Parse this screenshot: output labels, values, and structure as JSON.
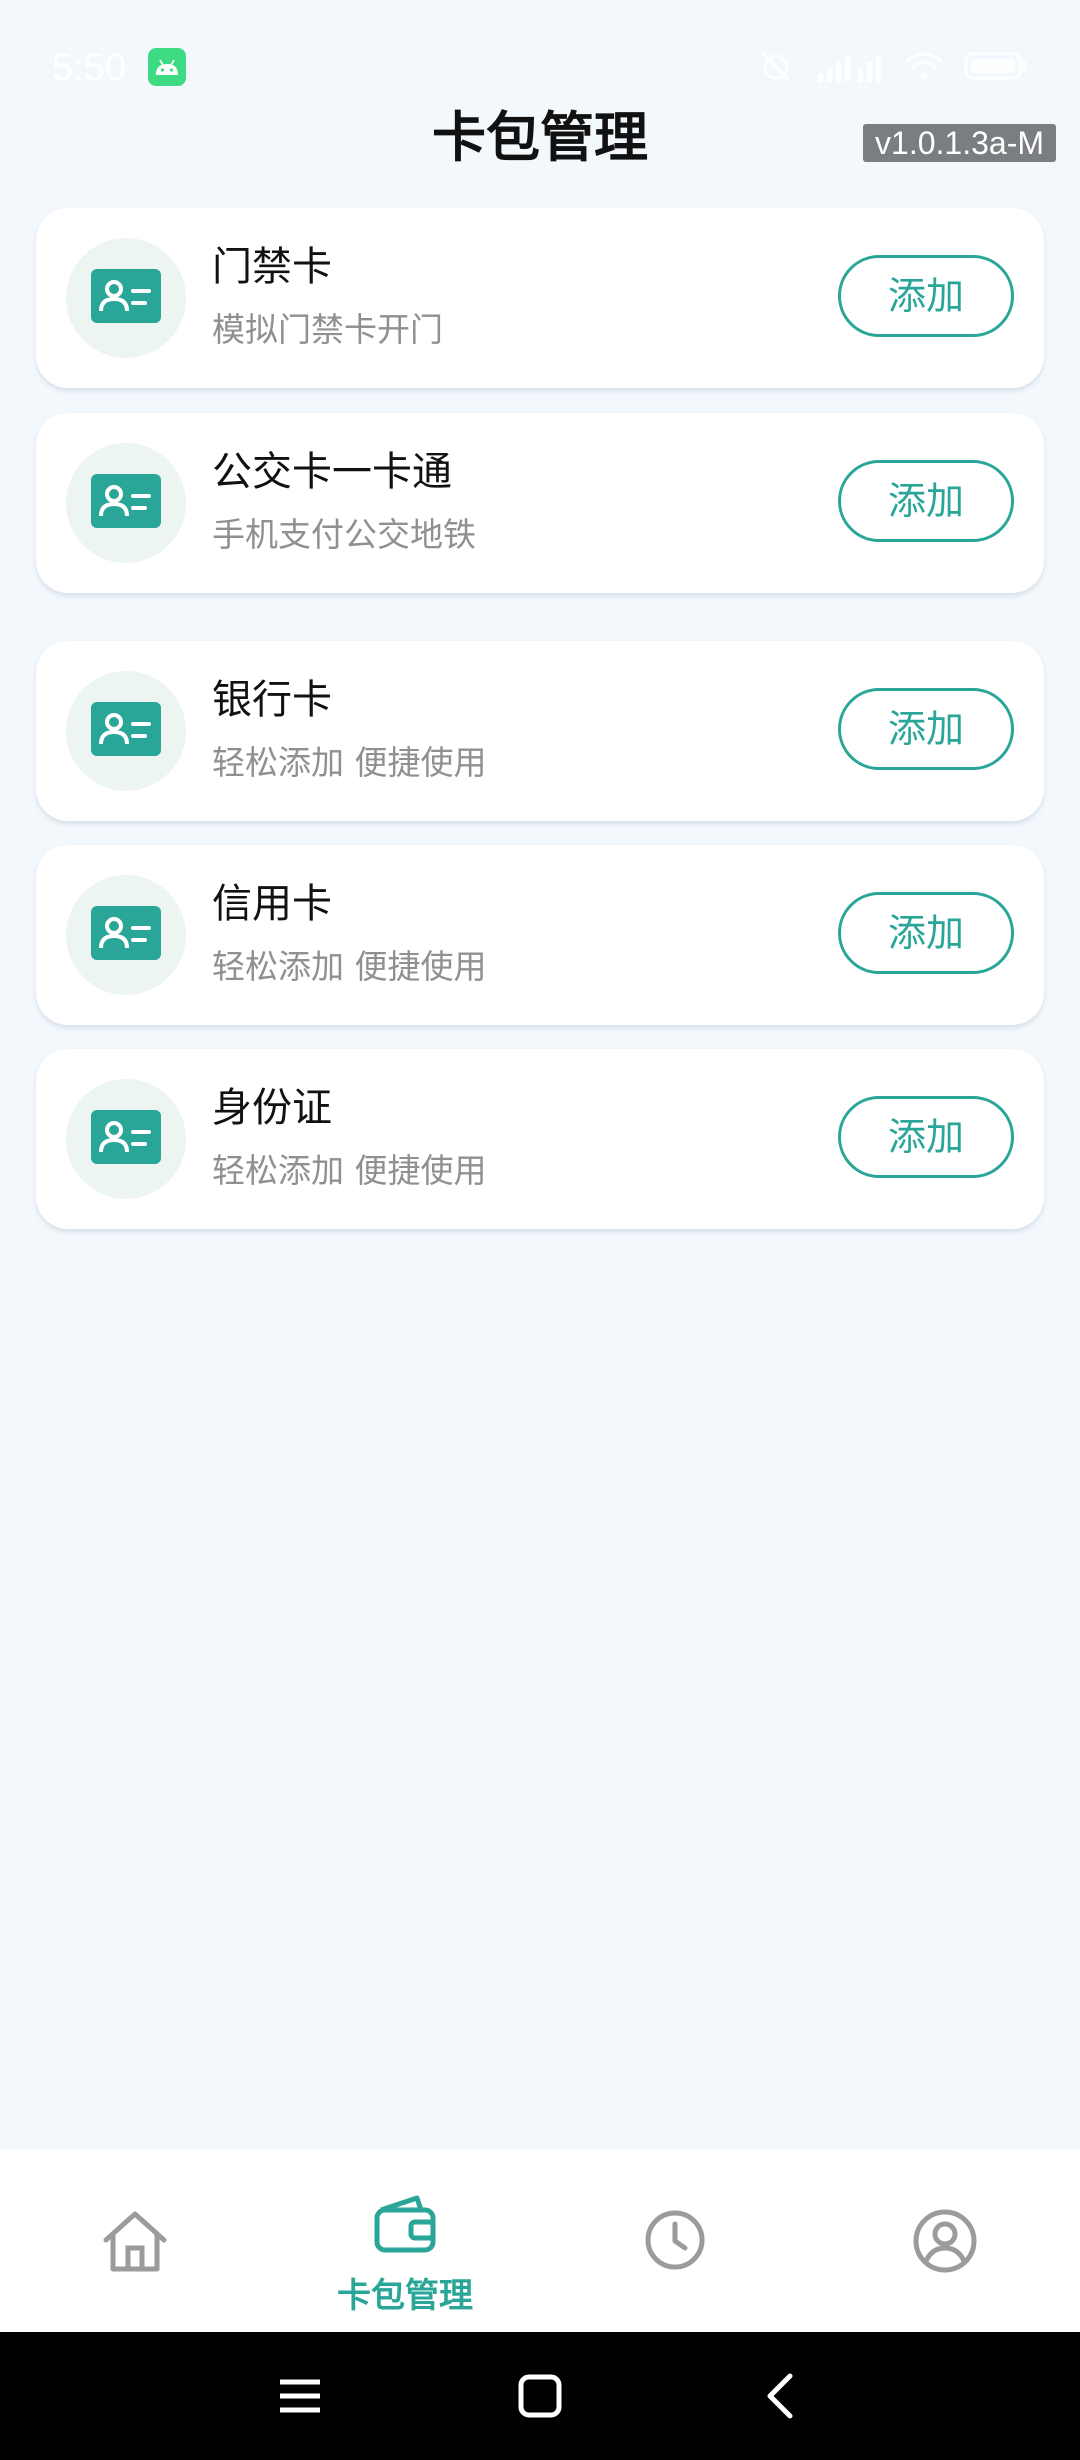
{
  "status_bar": {
    "time": "5:50",
    "app_icon": "android-icon",
    "icons": [
      "alarm-off-icon",
      "signal-icon",
      "wifi-icon",
      "battery-icon"
    ]
  },
  "header": {
    "title": "卡包管理",
    "version": "v1.0.1.3a-M"
  },
  "cards": [
    {
      "icon": "id-card-icon",
      "title": "门禁卡",
      "subtitle": "模拟门禁卡开门",
      "button": "添加"
    },
    {
      "icon": "id-card-icon",
      "title": "公交卡一卡通",
      "subtitle": "手机支付公交地铁",
      "button": "添加"
    },
    {
      "icon": "id-card-icon",
      "title": "银行卡",
      "subtitle": "轻松添加 便捷使用",
      "button": "添加"
    },
    {
      "icon": "id-card-icon",
      "title": "信用卡",
      "subtitle": "轻松添加 便捷使用",
      "button": "添加"
    },
    {
      "icon": "id-card-icon",
      "title": "身份证",
      "subtitle": "轻松添加 便捷使用",
      "button": "添加"
    }
  ],
  "tab_bar": {
    "tabs": [
      {
        "icon": "home-icon",
        "label": "",
        "active": false
      },
      {
        "icon": "wallet-icon",
        "label": "卡包管理",
        "active": true
      },
      {
        "icon": "clock-icon",
        "label": "",
        "active": false
      },
      {
        "icon": "profile-icon",
        "label": "",
        "active": false
      }
    ]
  },
  "system_nav": {
    "buttons": [
      "menu-icon",
      "home-square-icon",
      "back-icon"
    ]
  },
  "colors": {
    "accent": "#2aa699",
    "background": "#f3f8fd",
    "card": "#ffffff",
    "subtitle": "#8e9092",
    "icon_inactive": "#9b9b9b"
  }
}
